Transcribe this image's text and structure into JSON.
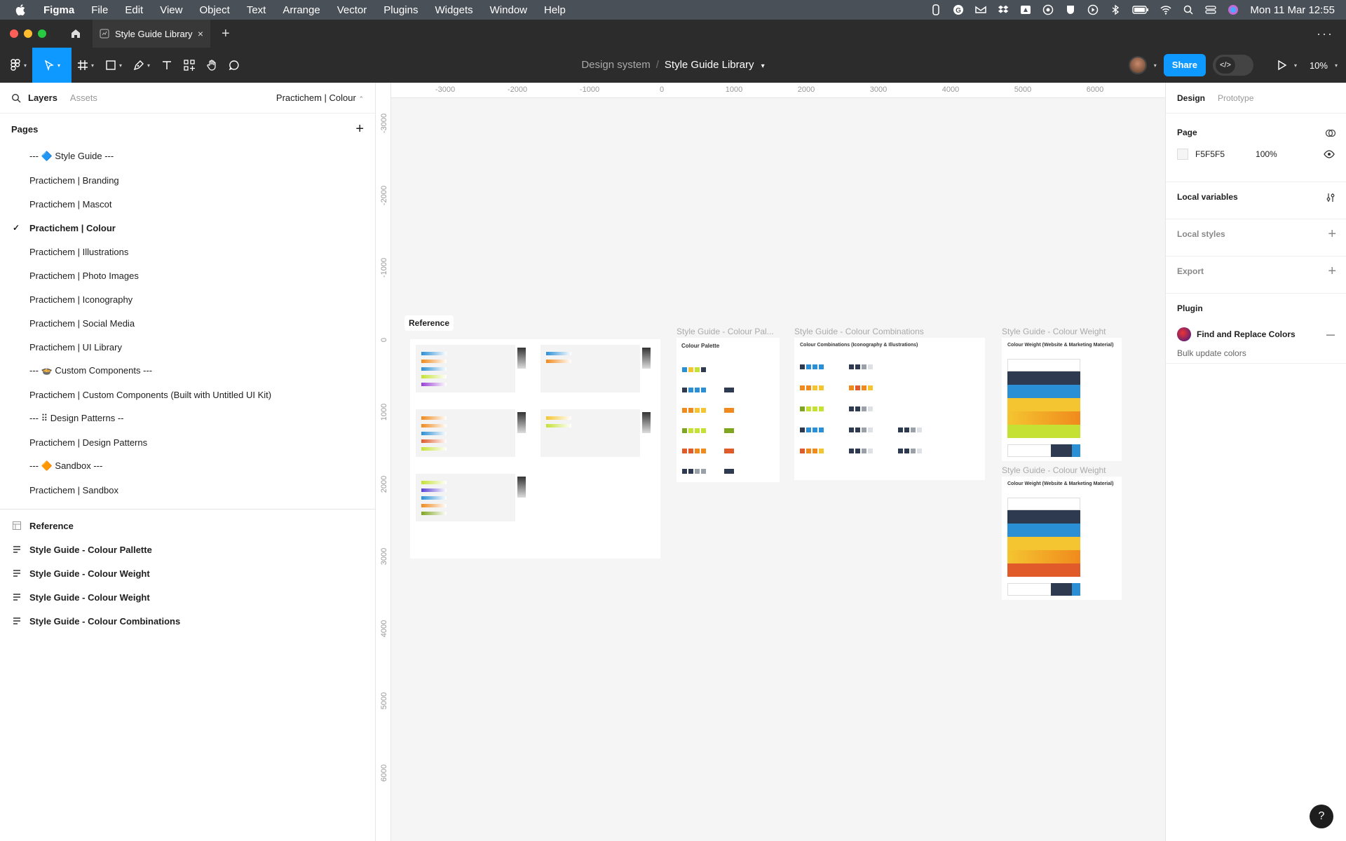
{
  "menubar": {
    "app": "Figma",
    "items": [
      "File",
      "Edit",
      "View",
      "Object",
      "Text",
      "Arrange",
      "Vector",
      "Plugins",
      "Widgets",
      "Window",
      "Help"
    ],
    "clock": "Mon 11 Mar  12:55"
  },
  "tabs": [
    {
      "label": "Style Guide Library",
      "close": "×"
    }
  ],
  "tab_add": "+",
  "tab_more": "···",
  "toolbar": {
    "breadcrumb_project": "Design system",
    "breadcrumb_sep": "/",
    "breadcrumb_file": "Style Guide Library",
    "share_label": "Share",
    "dev_label": "</>",
    "zoom": "10%"
  },
  "left": {
    "tab_layers": "Layers",
    "tab_assets": "Assets",
    "current_page": "Practichem | Colour",
    "pages_heading": "Pages",
    "add": "+",
    "check": "✓",
    "pages": [
      "--- 🔷 Style Guide ---",
      "Practichem | Branding",
      "Practichem | Mascot",
      "Practichem | Colour",
      "Practichem | Illustrations",
      "Practichem | Photo Images",
      "Practichem | Iconography",
      "Practichem | Social Media",
      "Practichem | UI Library",
      "--- 🍲 Custom Components ---",
      "Practichem | Custom Components (Built with Untitled UI Kit)",
      "--- ⠿ Design Patterns --",
      "Practichem | Design Patterns",
      "--- 🔶 Sandbox ---",
      "Practichem | Sandbox"
    ],
    "selected_page_index": 3,
    "layers": [
      {
        "label": "Reference",
        "icon": "frame-icon"
      },
      {
        "label": "Style Guide - Colour Pallette",
        "icon": "text-lines-icon"
      },
      {
        "label": "Style Guide - Colour Weight",
        "icon": "text-lines-icon"
      },
      {
        "label": "Style Guide - Colour Weight",
        "icon": "text-lines-icon"
      },
      {
        "label": "Style Guide - Colour Combinations",
        "icon": "text-lines-icon"
      }
    ]
  },
  "canvas": {
    "ruler_x": [
      "-3000",
      "-2000",
      "-1000",
      "0",
      "1000",
      "2000",
      "3000",
      "4000",
      "5000",
      "6000"
    ],
    "ruler_y": [
      "-3000",
      "-2000",
      "-1000",
      "0",
      "1000",
      "2000",
      "3000",
      "4000",
      "5000",
      "6000"
    ],
    "reference_tag": "Reference",
    "frame_labels": {
      "palette": "Style Guide - Colour Pal...",
      "combinations": "Style Guide - Colour Combinations",
      "weight1": "Style Guide - Colour Weight",
      "weight2": "Style Guide - Colour Weight"
    },
    "frame_titles": {
      "palette": "Colour Palette",
      "combinations": "Colour Combinations (Iconography & Illustrations)",
      "weight1": "Colour Weight (Website & Marketing Material)",
      "weight2": "Colour Weight (Website & Marketing Material)"
    },
    "colors": {
      "navy": "#2e3a4f",
      "blue": "#2b8fd6",
      "orange": "#f08a1c",
      "yellow": "#f4c531",
      "lime": "#c5e234",
      "green": "#7fa621",
      "red": "#e05a2a",
      "grey": "#9aa0a8"
    }
  },
  "right": {
    "tab_design": "Design",
    "tab_prototype": "Prototype",
    "page_heading": "Page",
    "page_color": "F5F5F5",
    "page_opacity": "100%",
    "local_variables": "Local variables",
    "local_styles": "Local styles",
    "export": "Export",
    "plugin_heading": "Plugin",
    "plugin_name": "Find and Replace Colors",
    "plugin_desc": "Bulk update colors",
    "plus": "+",
    "minus": "—"
  },
  "help": "?"
}
